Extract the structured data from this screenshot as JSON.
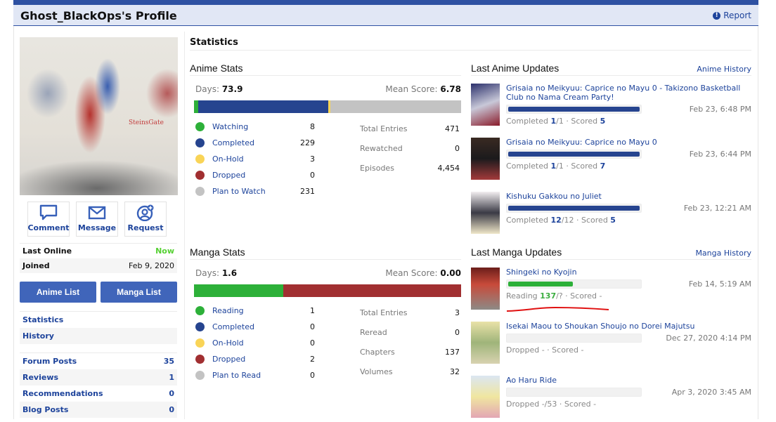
{
  "header": {
    "title": "Ghost_BlackOps's Profile",
    "report_label": "Report"
  },
  "sidebar": {
    "avatar_caption": "SteinsGate",
    "actions": [
      {
        "label": "Comment",
        "icon": "speech-bubble-icon"
      },
      {
        "label": "Message",
        "icon": "envelope-icon"
      },
      {
        "label": "Request",
        "icon": "add-friend-icon"
      }
    ],
    "info": [
      {
        "label": "Last Online",
        "value": "Now"
      },
      {
        "label": "Joined",
        "value": "Feb 9, 2020"
      }
    ],
    "list_buttons": {
      "anime": "Anime List",
      "manga": "Manga List"
    },
    "nav": [
      {
        "label": "Statistics"
      },
      {
        "label": "History"
      }
    ],
    "counts": [
      {
        "label": "Forum Posts",
        "value": "35"
      },
      {
        "label": "Reviews",
        "value": "1"
      },
      {
        "label": "Recommendations",
        "value": "0"
      },
      {
        "label": "Blog Posts",
        "value": "0"
      }
    ]
  },
  "statistics": {
    "title": "Statistics",
    "colors": {
      "green": "#2db039",
      "blue": "#26448f",
      "yellow": "#f9d457",
      "red": "#a12f31",
      "grey": "#c3c3c3"
    },
    "anime": {
      "heading": "Anime Stats",
      "days_label": "Days:",
      "days": "73.9",
      "mean_label": "Mean Score:",
      "mean": "6.78",
      "legend": [
        {
          "label": "Watching",
          "value": 8
        },
        {
          "label": "Completed",
          "value": 229
        },
        {
          "label": "On-Hold",
          "value": 3
        },
        {
          "label": "Dropped",
          "value": 0
        },
        {
          "label": "Plan to Watch",
          "value": 231
        }
      ],
      "extra": [
        {
          "label": "Total Entries",
          "value": "471"
        },
        {
          "label": "Rewatched",
          "value": "0"
        },
        {
          "label": "Episodes",
          "value": "4,454"
        }
      ]
    },
    "manga": {
      "heading": "Manga Stats",
      "days_label": "Days:",
      "days": "1.6",
      "mean_label": "Mean Score:",
      "mean": "0.00",
      "legend": [
        {
          "label": "Reading",
          "value": 1
        },
        {
          "label": "Completed",
          "value": 0
        },
        {
          "label": "On-Hold",
          "value": 0
        },
        {
          "label": "Dropped",
          "value": 2
        },
        {
          "label": "Plan to Read",
          "value": 0
        }
      ],
      "extra": [
        {
          "label": "Total Entries",
          "value": "3"
        },
        {
          "label": "Reread",
          "value": "0"
        },
        {
          "label": "Chapters",
          "value": "137"
        },
        {
          "label": "Volumes",
          "value": "32"
        }
      ]
    }
  },
  "anime_updates": {
    "heading": "Last Anime Updates",
    "history_link": "Anime History",
    "items": [
      {
        "title": "Grisaia no Meikyuu: Caprice no Mayu 0 - Takizono Basketball Club no Nama Cream Party!",
        "date": "Feb 23, 6:48 PM",
        "status": "Completed",
        "progress": "1",
        "total": "/1",
        "scored_label": "· Scored",
        "score": "5",
        "fraction": 1.0
      },
      {
        "title": "Grisaia no Meikyuu: Caprice no Mayu 0",
        "date": "Feb 23, 6:44 PM",
        "status": "Completed",
        "progress": "1",
        "total": "/1",
        "scored_label": "· Scored",
        "score": "7",
        "fraction": 1.0
      },
      {
        "title": "Kishuku Gakkou no Juliet",
        "date": "Feb 23, 12:21 AM",
        "status": "Completed",
        "progress": "12",
        "total": "/12",
        "scored_label": "· Scored",
        "score": "5",
        "fraction": 1.0
      }
    ]
  },
  "manga_updates": {
    "heading": "Last Manga Updates",
    "history_link": "Manga History",
    "items": [
      {
        "title": "Shingeki no Kyojin",
        "date": "Feb 14, 5:19 AM",
        "status": "Reading",
        "progress": "137",
        "rest": "/? · Scored -",
        "fraction": 0.5
      },
      {
        "title": "Isekai Maou to Shoukan Shoujo no Dorei Majutsu",
        "date": "Dec 27, 2020 4:14 PM",
        "status": "Dropped",
        "progress": "",
        "rest": " - · Scored -",
        "fraction": 0
      },
      {
        "title": "Ao Haru Ride",
        "date": "Apr 3, 2020 3:45 AM",
        "status": "Dropped",
        "progress": "",
        "rest": " -/53 · Scored -",
        "fraction": 0
      }
    ]
  }
}
